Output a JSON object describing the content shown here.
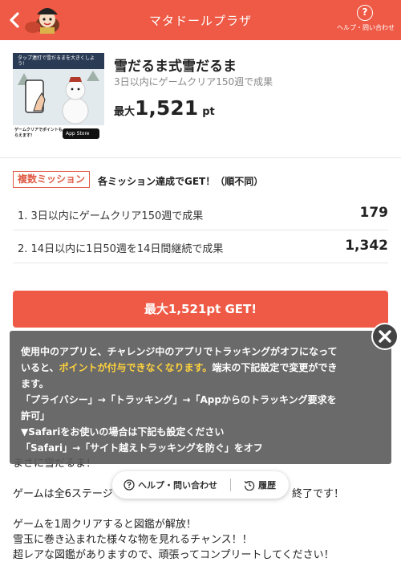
{
  "header": {
    "title": "マタドールプラザ",
    "help_label": "ヘルプ・問い合わせ",
    "help_glyph": "?"
  },
  "game": {
    "title": "雪だるま式雪だるま",
    "subtitle": "3日以内にゲームクリア150週で成果",
    "max_prefix": "最大",
    "max_points": "1,521",
    "max_unit": "pt",
    "thumbnail": {
      "banner_text": "タップ連打で雪だるまを大きくしよう!",
      "caption": "ゲームクリアでポイントもらえます!",
      "store_badge": "App Store"
    }
  },
  "missions": {
    "badge": "複数ミッション",
    "note": "各ミッション達成でGET！（順不同）",
    "items": [
      {
        "label": "1. 3日以内にゲームクリア150週で成果",
        "points": "179"
      },
      {
        "label": "2. 14日以内に1日50週を14日間継続で成果",
        "points": "1,342"
      }
    ]
  },
  "cta": {
    "label": "最大1,521pt GET!"
  },
  "overlay": {
    "line1": "使用中のアプリと、チャレンジ中のアプリでトラッキングがオフになって",
    "line2a": "いると、",
    "line2b": "ポイントが付与できなくなります。",
    "line2c": "端末の下記設定で変更ができ",
    "line3": "ます。",
    "line4": "「プライバシー」→「トラッキング」→「Appからのトラッキング要求を",
    "line5": "許可」",
    "line6": "▼Safariをお使いの場合は下記も設定ください",
    "line7": "「Safari」→「サイト越えトラッキングを防ぐ」をオフ"
  },
  "description": {
    "visible_lines": [
      "まさに雪だるま！",
      "ゲームは全6ステージ",
      "終了です！",
      "ゲームを1周クリアすると図鑑が解放！",
      "雪玉に巻き込まれた様々な物を見れるチャンス！！",
      "超レアな図鑑がありますので、頑張ってコンプリートしてください！"
    ]
  },
  "bottom_pill": {
    "help_label": "ヘルプ・問い合わせ",
    "history_label": "履歴"
  },
  "colors": {
    "accent": "#ee5a45",
    "highlight": "#ffd23d",
    "overlay_bg": "#5a5a5a"
  },
  "icons": {
    "back": "chevron-left-icon",
    "help": "question-circle-icon",
    "close": "close-icon",
    "history": "history-icon"
  }
}
